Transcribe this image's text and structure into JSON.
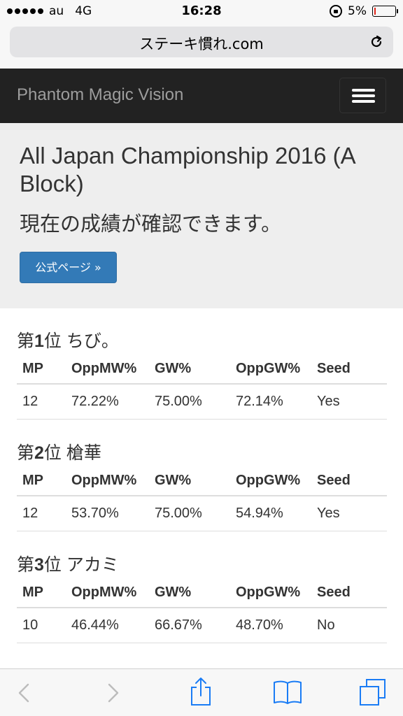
{
  "status_bar": {
    "carrier": "au",
    "network": "4G",
    "time": "16:28",
    "battery": "5%",
    "battery_level": 0.05
  },
  "url_bar": {
    "domain": "ステーキ慣れ.com"
  },
  "navbar": {
    "brand": "Phantom Magic Vision"
  },
  "jumbotron": {
    "title": "All Japan Championship 2016 (A Block)",
    "subtitle": "現在の成績が確認できます。",
    "button_label": "公式ページ »"
  },
  "standings": [
    {
      "rank_prefix": "第",
      "rank_number": "1",
      "rank_suffix": "位",
      "player": "ちび。",
      "headers": [
        "MP",
        "OppMW%",
        "GW%",
        "OppGW%",
        "Seed"
      ],
      "values": [
        "12",
        "72.22%",
        "75.00%",
        "72.14%",
        "Yes"
      ]
    },
    {
      "rank_prefix": "第",
      "rank_number": "2",
      "rank_suffix": "位",
      "player": "槍華",
      "headers": [
        "MP",
        "OppMW%",
        "GW%",
        "OppGW%",
        "Seed"
      ],
      "values": [
        "12",
        "53.70%",
        "75.00%",
        "54.94%",
        "Yes"
      ]
    },
    {
      "rank_prefix": "第",
      "rank_number": "3",
      "rank_suffix": "位",
      "player": "アカミ",
      "headers": [
        "MP",
        "OppMW%",
        "GW%",
        "OppGW%",
        "Seed"
      ],
      "values": [
        "10",
        "46.44%",
        "66.67%",
        "48.70%",
        "No"
      ]
    }
  ],
  "toolbar": {
    "icons": [
      "back-icon",
      "forward-icon",
      "share-icon",
      "bookmarks-icon",
      "tabs-icon"
    ],
    "accent_color": "#1a7cf5",
    "disabled_color": "#bcbcbc"
  },
  "colors": {
    "navbar_bg": "#222222",
    "jumbotron_bg": "#eeeeee",
    "primary_button": "#337ab7"
  }
}
